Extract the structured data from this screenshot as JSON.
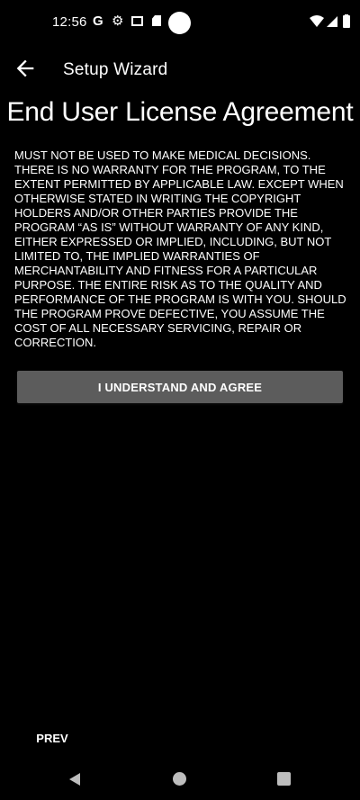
{
  "status_bar": {
    "time": "12:56",
    "google_icon": "G",
    "gear_icon": "⚙",
    "icons_right": [
      "wifi-icon",
      "cell-signal-icon",
      "battery-icon"
    ]
  },
  "app_bar": {
    "title": "Setup Wizard",
    "back_icon": "arrow-back-icon"
  },
  "page": {
    "heading": "End User License Agreement",
    "license_text": "MUST NOT BE USED TO MAKE MEDICAL DECISIONS. THERE IS NO WARRANTY FOR THE PROGRAM, TO THE EXTENT PERMITTED BY APPLICABLE LAW. EXCEPT WHEN OTHERWISE STATED IN WRITING THE COPYRIGHT HOLDERS AND/OR OTHER PARTIES PROVIDE THE PROGRAM “AS IS” WITHOUT WARRANTY OF ANY KIND, EITHER EXPRESSED OR IMPLIED, INCLUDING, BUT NOT LIMITED TO, THE IMPLIED WARRANTIES OF MERCHANTABILITY AND FITNESS FOR A PARTICULAR PURPOSE. THE ENTIRE RISK AS TO THE QUALITY AND PERFORMANCE OF THE PROGRAM IS WITH YOU. SHOULD THE PROGRAM PROVE DEFECTIVE, YOU ASSUME THE COST OF ALL NECESSARY SERVICING, REPAIR OR CORRECTION.",
    "agree_label": "I UNDERSTAND AND AGREE",
    "prev_label": "PREV"
  },
  "colors": {
    "background": "#000000",
    "text": "#ffffff",
    "button": "#5c5c5c",
    "nav_icons": "#bdbdbd"
  }
}
